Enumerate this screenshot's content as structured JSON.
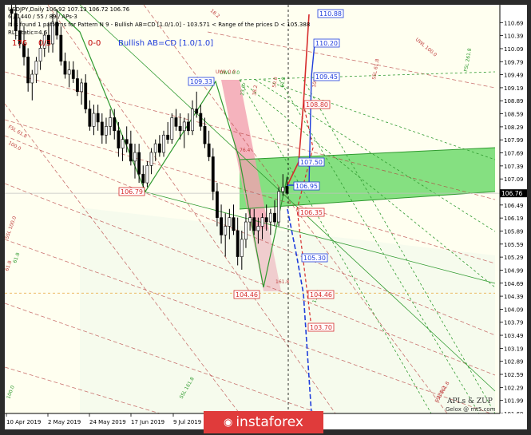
{
  "header": {
    "line1": "USDJPY,Daily 106.92 107.13 106.72 106.76",
    "line2": "6 / 1440 / 55 / 89 / APs-3",
    "line3": "It is found 1 patterns    for Pattern N 9 - Bullish AB=CD [1.0/1.0] - 103.571 < Range of the prices D < 105.388",
    "line4": "RL_Static=4.6",
    "count_red": "176",
    "ratio_red": "0/3",
    "zero_red": "0-0",
    "pattern_blue": "Bullish AB=CD [1.0/1.0]"
  },
  "watermark": {
    "text": "instaforex",
    "icon": "insta-icon"
  },
  "brand": {
    "line1": "APLs & ZUP",
    "line2": "Gelox @ mt5.com"
  },
  "colors": {
    "background": "#fffff0",
    "green_channel": "#5cd65c",
    "pink_zone": "#f3a0b0",
    "red": "#d62b2b",
    "blue": "#1f3ddb",
    "green_line": "#2f9a2f"
  },
  "chart_data": {
    "type": "candlestick",
    "symbol": "USDJPY",
    "timeframe": "Daily",
    "ylim": [
      101.69,
      111.1
    ],
    "y_ticks": [
      "110.69",
      "110.39",
      "110.09",
      "109.79",
      "109.49",
      "109.19",
      "108.89",
      "108.59",
      "108.29",
      "107.99",
      "107.69",
      "107.39",
      "107.09",
      "106.79",
      "106.49",
      "106.19",
      "105.89",
      "105.59",
      "105.29",
      "104.99",
      "104.69",
      "104.39",
      "104.09",
      "103.79",
      "103.49",
      "103.19",
      "102.89",
      "102.59",
      "102.29",
      "101.99",
      "101.69"
    ],
    "x_ticks": [
      "10 Apr 2019",
      "2 May 2019",
      "24 May 2019",
      "17 Jun 2019",
      "9 Jul 2019"
    ],
    "current_price": "106.76",
    "price_labels": [
      {
        "value": 110.88,
        "text": "110.88",
        "color": "blue"
      },
      {
        "value": 110.2,
        "text": "110.20",
        "color": "blue"
      },
      {
        "value": 109.45,
        "text": "109.45",
        "color": "blue"
      },
      {
        "value": 109.33,
        "text": "109.33",
        "color": "blue"
      },
      {
        "value": 108.8,
        "text": "108.80",
        "color": "red"
      },
      {
        "value": 107.5,
        "text": "107.50",
        "color": "blue"
      },
      {
        "value": 106.95,
        "text": "106.95",
        "color": "blue"
      },
      {
        "value": 106.79,
        "text": "106.79",
        "color": "red"
      },
      {
        "value": 106.35,
        "text": "106.35",
        "color": "red"
      },
      {
        "value": 105.3,
        "text": "105.30",
        "color": "blue"
      },
      {
        "value": 104.46,
        "text": "104.46",
        "color": "red"
      },
      {
        "value": 104.46,
        "text": "104.46",
        "color": "red"
      },
      {
        "value": 103.7,
        "text": "103.70",
        "color": "red"
      }
    ],
    "fib_labels": [
      "UWL 0.0",
      "UWL 100.0",
      "UWL 0.0",
      "23.6",
      "38.2",
      "50.0",
      "61.8",
      "FSL 61.8",
      "FSL 161.8",
      "FSL 261.8",
      "SSL 61.8",
      "SSL 100.0",
      "SSL 161.8",
      "18.2",
      "61.8",
      "61.8",
      "100.0",
      "76.4",
      "138.2",
      "161.8",
      "100.0",
      "100.0",
      "138.2"
    ],
    "candles": [
      {
        "o": 111.0,
        "h": 111.2,
        "l": 110.6,
        "c": 110.9
      },
      {
        "o": 110.9,
        "h": 111.1,
        "l": 110.3,
        "c": 110.5
      },
      {
        "o": 110.5,
        "h": 110.8,
        "l": 110.1,
        "c": 110.2
      },
      {
        "o": 110.2,
        "h": 110.6,
        "l": 109.7,
        "c": 109.9
      },
      {
        "o": 109.9,
        "h": 110.1,
        "l": 109.1,
        "c": 109.3
      },
      {
        "o": 109.3,
        "h": 109.6,
        "l": 108.9,
        "c": 109.5
      },
      {
        "o": 109.5,
        "h": 109.9,
        "l": 109.3,
        "c": 109.8
      },
      {
        "o": 109.8,
        "h": 110.3,
        "l": 109.6,
        "c": 110.1
      },
      {
        "o": 110.1,
        "h": 110.5,
        "l": 109.9,
        "c": 110.4
      },
      {
        "o": 110.4,
        "h": 110.7,
        "l": 110.0,
        "c": 110.2
      },
      {
        "o": 110.2,
        "h": 110.9,
        "l": 110.0,
        "c": 110.7
      },
      {
        "o": 110.7,
        "h": 111.0,
        "l": 110.3,
        "c": 110.4
      },
      {
        "o": 110.4,
        "h": 110.6,
        "l": 109.7,
        "c": 109.8
      },
      {
        "o": 109.8,
        "h": 110.0,
        "l": 109.4,
        "c": 109.5
      },
      {
        "o": 109.5,
        "h": 109.8,
        "l": 109.2,
        "c": 109.6
      },
      {
        "o": 109.6,
        "h": 109.8,
        "l": 109.3,
        "c": 109.4
      },
      {
        "o": 109.4,
        "h": 109.6,
        "l": 109.0,
        "c": 109.1
      },
      {
        "o": 109.1,
        "h": 109.4,
        "l": 108.8,
        "c": 109.3
      },
      {
        "o": 109.3,
        "h": 109.5,
        "l": 108.6,
        "c": 108.7
      },
      {
        "o": 108.7,
        "h": 108.9,
        "l": 108.2,
        "c": 108.3
      },
      {
        "o": 108.3,
        "h": 108.8,
        "l": 108.1,
        "c": 108.6
      },
      {
        "o": 108.6,
        "h": 108.8,
        "l": 108.2,
        "c": 108.4
      },
      {
        "o": 108.4,
        "h": 108.6,
        "l": 107.9,
        "c": 108.1
      },
      {
        "o": 108.1,
        "h": 108.5,
        "l": 107.9,
        "c": 108.3
      },
      {
        "o": 108.3,
        "h": 108.7,
        "l": 108.1,
        "c": 108.5
      },
      {
        "o": 108.5,
        "h": 108.7,
        "l": 108.0,
        "c": 108.2
      },
      {
        "o": 108.2,
        "h": 108.4,
        "l": 107.6,
        "c": 107.8
      },
      {
        "o": 107.8,
        "h": 108.1,
        "l": 107.5,
        "c": 108.0
      },
      {
        "o": 108.0,
        "h": 108.3,
        "l": 107.7,
        "c": 107.9
      },
      {
        "o": 107.9,
        "h": 108.2,
        "l": 107.4,
        "c": 107.5
      },
      {
        "o": 107.5,
        "h": 107.9,
        "l": 107.1,
        "c": 107.7
      },
      {
        "o": 107.7,
        "h": 107.9,
        "l": 107.0,
        "c": 107.2
      },
      {
        "o": 107.2,
        "h": 107.4,
        "l": 106.8,
        "c": 107.0
      },
      {
        "o": 107.0,
        "h": 107.5,
        "l": 106.9,
        "c": 107.4
      },
      {
        "o": 107.4,
        "h": 107.8,
        "l": 107.2,
        "c": 107.7
      },
      {
        "o": 107.7,
        "h": 108.0,
        "l": 107.5,
        "c": 107.9
      },
      {
        "o": 107.9,
        "h": 108.1,
        "l": 107.6,
        "c": 107.7
      },
      {
        "o": 107.7,
        "h": 108.2,
        "l": 107.6,
        "c": 108.1
      },
      {
        "o": 108.1,
        "h": 108.4,
        "l": 107.9,
        "c": 108.0
      },
      {
        "o": 108.0,
        "h": 108.6,
        "l": 107.9,
        "c": 108.5
      },
      {
        "o": 108.5,
        "h": 108.7,
        "l": 108.2,
        "c": 108.3
      },
      {
        "o": 108.3,
        "h": 108.6,
        "l": 108.0,
        "c": 108.2
      },
      {
        "o": 108.2,
        "h": 108.5,
        "l": 107.8,
        "c": 108.4
      },
      {
        "o": 108.4,
        "h": 108.6,
        "l": 108.1,
        "c": 108.2
      },
      {
        "o": 108.2,
        "h": 108.9,
        "l": 108.1,
        "c": 108.7
      },
      {
        "o": 108.7,
        "h": 109.1,
        "l": 108.5,
        "c": 108.6
      },
      {
        "o": 108.6,
        "h": 108.8,
        "l": 108.2,
        "c": 108.3
      },
      {
        "o": 108.3,
        "h": 108.5,
        "l": 107.8,
        "c": 107.9
      },
      {
        "o": 107.9,
        "h": 108.2,
        "l": 107.5,
        "c": 107.6
      },
      {
        "o": 107.6,
        "h": 107.8,
        "l": 106.6,
        "c": 106.8
      },
      {
        "o": 106.8,
        "h": 107.0,
        "l": 106.0,
        "c": 106.2
      },
      {
        "o": 106.2,
        "h": 106.5,
        "l": 105.6,
        "c": 105.8
      },
      {
        "o": 105.8,
        "h": 106.3,
        "l": 105.3,
        "c": 106.0
      },
      {
        "o": 106.0,
        "h": 106.4,
        "l": 105.7,
        "c": 106.2
      },
      {
        "o": 106.2,
        "h": 106.5,
        "l": 105.8,
        "c": 105.9
      },
      {
        "o": 105.9,
        "h": 106.2,
        "l": 105.1,
        "c": 105.3
      },
      {
        "o": 105.3,
        "h": 105.9,
        "l": 105.0,
        "c": 105.7
      },
      {
        "o": 105.7,
        "h": 106.3,
        "l": 105.5,
        "c": 106.1
      },
      {
        "o": 106.1,
        "h": 106.4,
        "l": 105.9,
        "c": 106.2
      },
      {
        "o": 106.2,
        "h": 106.4,
        "l": 105.8,
        "c": 105.9
      },
      {
        "o": 105.9,
        "h": 106.2,
        "l": 105.6,
        "c": 106.0
      },
      {
        "o": 106.0,
        "h": 106.3,
        "l": 105.7,
        "c": 106.2
      },
      {
        "o": 106.2,
        "h": 106.5,
        "l": 105.9,
        "c": 106.1
      },
      {
        "o": 106.1,
        "h": 106.4,
        "l": 105.8,
        "c": 106.3
      },
      {
        "o": 106.3,
        "h": 106.6,
        "l": 106.0,
        "c": 106.1
      },
      {
        "o": 106.1,
        "h": 106.9,
        "l": 106.0,
        "c": 106.8
      },
      {
        "o": 106.8,
        "h": 107.2,
        "l": 106.7,
        "c": 106.9
      },
      {
        "o": 106.92,
        "h": 107.13,
        "l": 106.72,
        "c": 106.76
      }
    ]
  }
}
